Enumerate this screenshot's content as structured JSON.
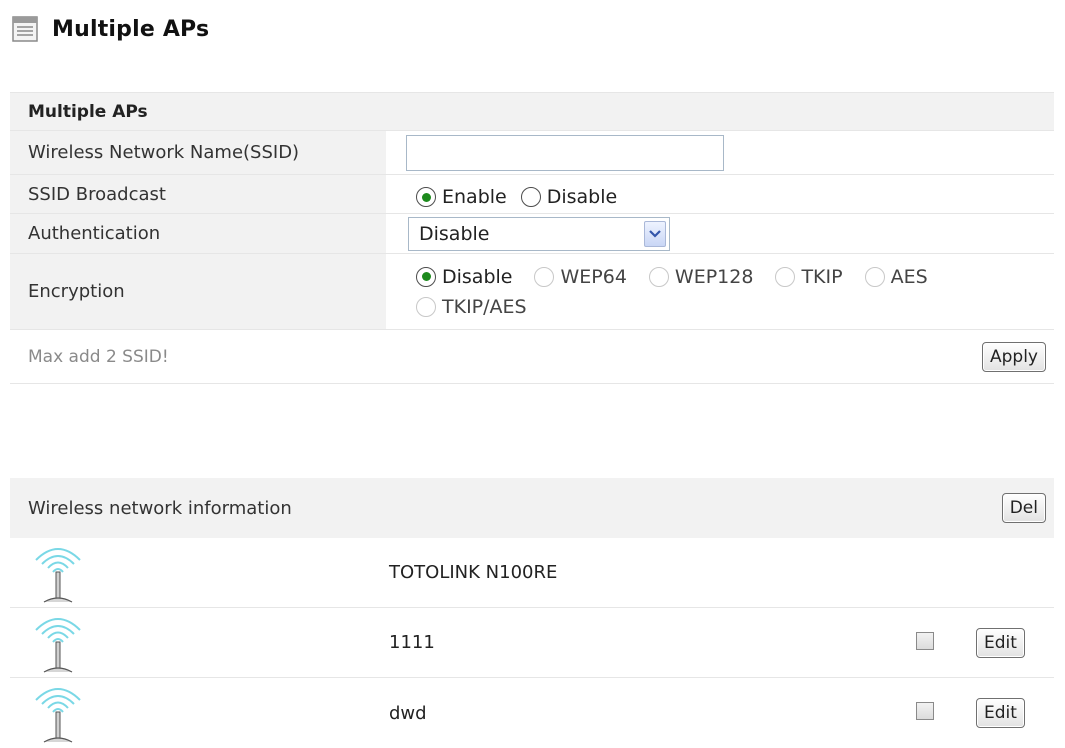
{
  "page": {
    "title": "Multiple APs"
  },
  "form": {
    "section_title": "Multiple APs",
    "ssid": {
      "label": "Wireless Network Name(SSID)",
      "value": "",
      "placeholder": ""
    },
    "broadcast": {
      "label": "SSID Broadcast",
      "options": [
        "Enable",
        "Disable"
      ],
      "selected": "Enable"
    },
    "authentication": {
      "label": "Authentication",
      "selected": "Disable"
    },
    "encryption": {
      "label": "Encryption",
      "options": [
        "Disable",
        "WEP64",
        "WEP128",
        "TKIP",
        "AES",
        "TKIP/AES"
      ],
      "selected": "Disable"
    },
    "note": "Max add 2 SSID!",
    "apply_label": "Apply"
  },
  "network_info": {
    "title": "Wireless network information",
    "del_label": "Del",
    "entries": [
      {
        "name": "TOTOLINK N100RE",
        "has_controls": false
      },
      {
        "name": "1111",
        "has_controls": true,
        "edit_label": "Edit"
      },
      {
        "name": "dwd",
        "has_controls": true,
        "edit_label": "Edit"
      }
    ]
  },
  "colors": {
    "row_shade": "#f2f2f2",
    "radio_dot": "#1d8a1d",
    "wifi_icon": "#5ad1e0"
  }
}
